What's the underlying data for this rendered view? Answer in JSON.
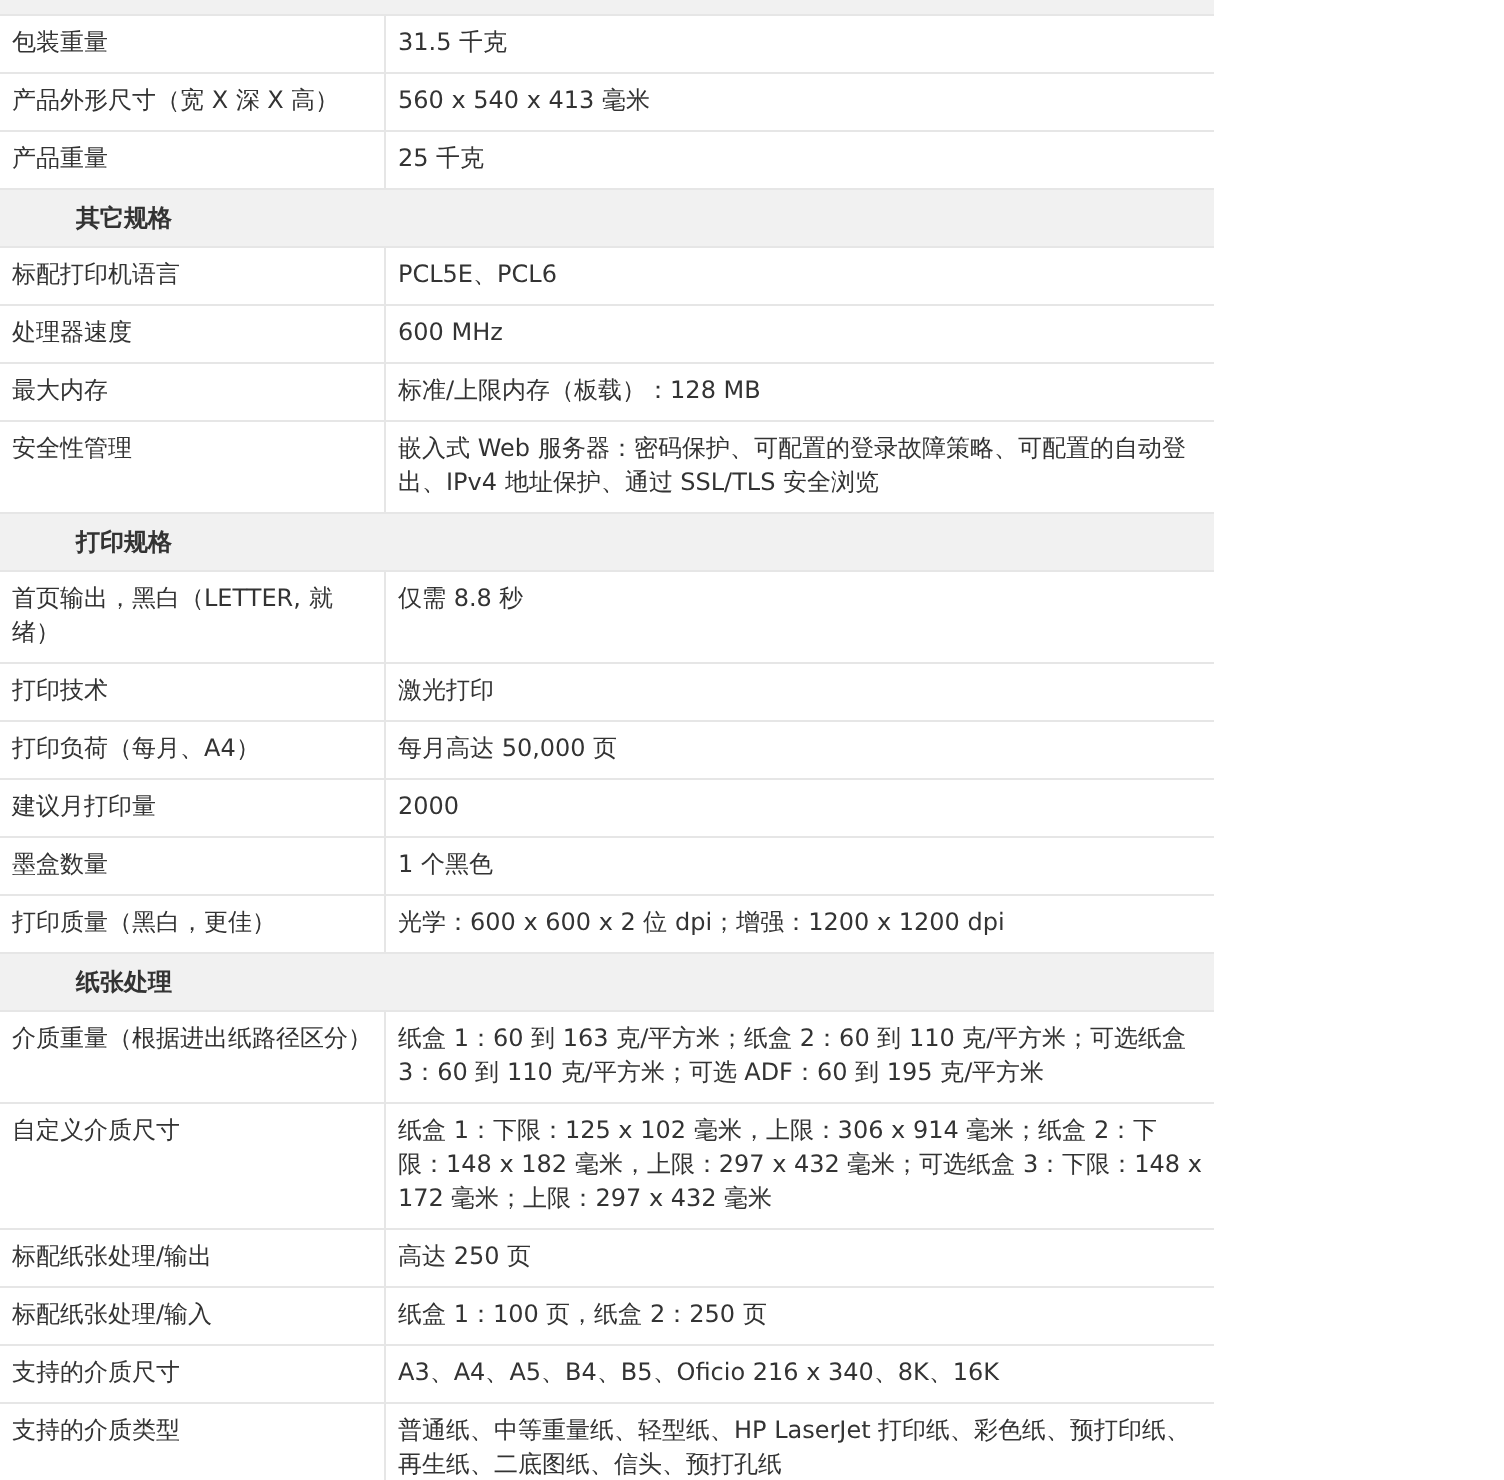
{
  "rows": [
    {
      "kind": "spec",
      "label": "包装重量",
      "value": "31.5 千克"
    },
    {
      "kind": "spec",
      "label": "产品外形尺寸（宽 X 深 X 高）",
      "value": "560 x 540 x 413 毫米"
    },
    {
      "kind": "spec",
      "label": "产品重量",
      "value": "25 千克"
    },
    {
      "kind": "section",
      "label": "其它规格"
    },
    {
      "kind": "spec",
      "label": "标配打印机语言",
      "value": "PCL5E、PCL6"
    },
    {
      "kind": "spec",
      "label": "处理器速度",
      "value": "600 MHz"
    },
    {
      "kind": "spec",
      "label": "最大内存",
      "value": "标准/上限内存（板载）：128 MB"
    },
    {
      "kind": "spec",
      "label": "安全性管理",
      "value": "嵌入式 Web 服务器：密码保护、可配置的登录故障策略、可配置的自动登出、IPv4 地址保护、通过 SSL/TLS 安全浏览"
    },
    {
      "kind": "section",
      "label": "打印规格"
    },
    {
      "kind": "spec",
      "label": "首页输出，黑白（LETTER, 就绪）",
      "value": "仅需 8.8 秒"
    },
    {
      "kind": "spec",
      "label": "打印技术",
      "value": "激光打印"
    },
    {
      "kind": "spec",
      "label": "打印负荷（每月、A4）",
      "value": "每月高达 50,000 页"
    },
    {
      "kind": "spec",
      "label": "建议月打印量",
      "value": "2000"
    },
    {
      "kind": "spec",
      "label": "墨盒数量",
      "value": "1 个黑色"
    },
    {
      "kind": "spec",
      "label": "打印质量（黑白，更佳）",
      "value": "光学：600 x 600 x 2 位 dpi；增强：1200 x 1200 dpi"
    },
    {
      "kind": "section",
      "label": "纸张处理"
    },
    {
      "kind": "spec",
      "label": "介质重量（根据进出纸路径区分）",
      "value": "纸盒 1：60 到 163 克/平方米；纸盒 2：60 到 110 克/平方米；可选纸盒 3：60 到 110 克/平方米；可选 ADF：60 到 195 克/平方米"
    },
    {
      "kind": "spec",
      "label": "自定义介质尺寸",
      "value": "纸盒 1：下限：125 x 102 毫米，上限：306 x 914 毫米；纸盒 2：下限：148 x 182 毫米，上限：297 x 432 毫米；可选纸盒 3：下限：148 x 172 毫米；上限：297 x 432 毫米"
    },
    {
      "kind": "spec",
      "label": "标配纸张处理/输出",
      "value": "高达 250 页"
    },
    {
      "kind": "spec",
      "label": "标配纸张处理/输入",
      "value": "纸盒 1：100 页，纸盒 2：250 页"
    },
    {
      "kind": "spec",
      "label": "支持的介质尺寸",
      "value": "A3、A4、A5、B4、B5、Oficio 216 x 340、8K、16K"
    },
    {
      "kind": "spec",
      "label": "支持的介质类型",
      "value": "普通纸、中等重量纸、轻型纸、HP LaserJet 打印纸、彩色纸、预打印纸、再生纸、二底图纸、信头、预打孔纸"
    }
  ]
}
